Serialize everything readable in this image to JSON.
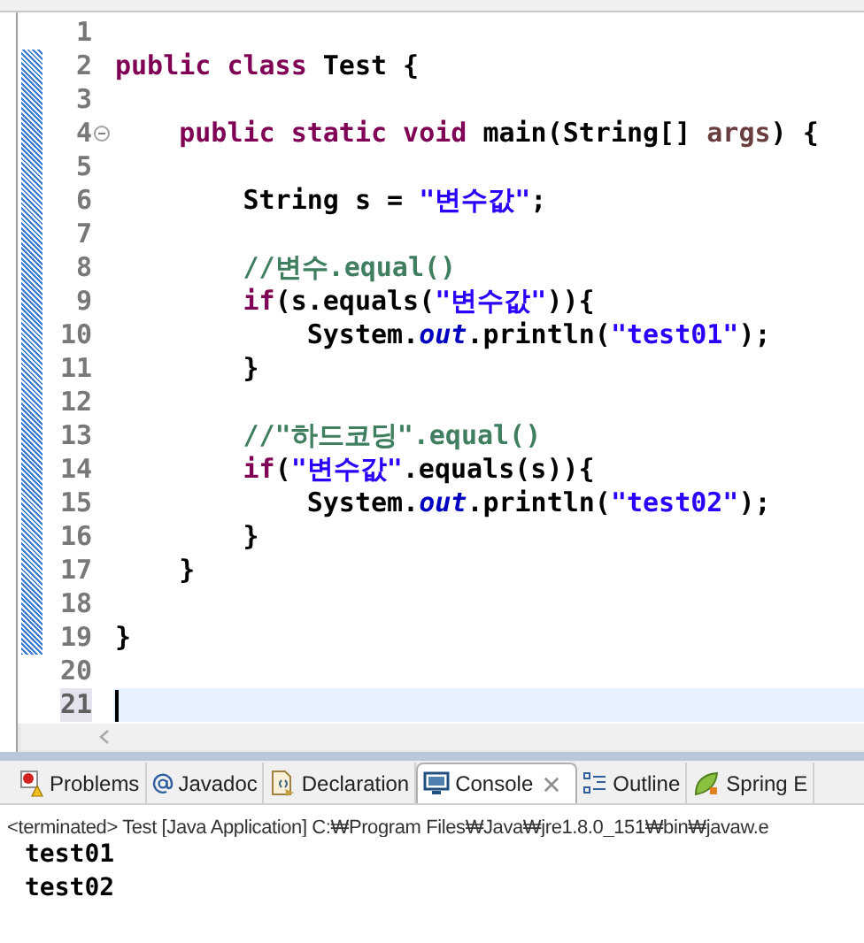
{
  "editor": {
    "lines": [
      {
        "number": "1",
        "current": false
      },
      {
        "number": "2",
        "current": false,
        "tokens": [
          {
            "kind": "keyword",
            "text": "public class"
          },
          {
            "kind": "plain",
            "text": " Test {"
          }
        ]
      },
      {
        "number": "3",
        "current": false
      },
      {
        "number": "4",
        "current": false,
        "fold": {
          "expanded": true
        },
        "tokens": [
          {
            "kind": "keyword",
            "text": "    public static void"
          },
          {
            "kind": "plain",
            "text": " main(String[] "
          },
          {
            "kind": "param",
            "text": "args"
          },
          {
            "kind": "plain",
            "text": ") {"
          }
        ]
      },
      {
        "number": "5",
        "current": false
      },
      {
        "number": "6",
        "current": false,
        "tokens": [
          {
            "kind": "plain",
            "text": "        String "
          },
          {
            "kind": "local",
            "text": "s"
          },
          {
            "kind": "plain",
            "text": " = "
          },
          {
            "kind": "string",
            "text": "\"변수값\""
          },
          {
            "kind": "plain",
            "text": ";"
          }
        ]
      },
      {
        "number": "7",
        "current": false
      },
      {
        "number": "8",
        "current": false,
        "tokens": [
          {
            "kind": "comment",
            "text": "        //변수.equal()"
          }
        ]
      },
      {
        "number": "9",
        "current": false,
        "tokens": [
          {
            "kind": "keyword",
            "text": "        if"
          },
          {
            "kind": "plain",
            "text": "("
          },
          {
            "kind": "local",
            "text": "s"
          },
          {
            "kind": "plain",
            "text": ".equals("
          },
          {
            "kind": "string",
            "text": "\"변수값\""
          },
          {
            "kind": "plain",
            "text": ")){"
          }
        ]
      },
      {
        "number": "10",
        "current": false,
        "tokens": [
          {
            "kind": "plain",
            "text": "            System."
          },
          {
            "kind": "field",
            "text": "out"
          },
          {
            "kind": "plain",
            "text": ".println("
          },
          {
            "kind": "string",
            "text": "\"test01\""
          },
          {
            "kind": "plain",
            "text": ");"
          }
        ]
      },
      {
        "number": "11",
        "current": false,
        "tokens": [
          {
            "kind": "plain",
            "text": "        }"
          }
        ]
      },
      {
        "number": "12",
        "current": false
      },
      {
        "number": "13",
        "current": false,
        "tokens": [
          {
            "kind": "comment",
            "text": "        //\"하드코딩\".equal()"
          }
        ]
      },
      {
        "number": "14",
        "current": false,
        "tokens": [
          {
            "kind": "keyword",
            "text": "        if"
          },
          {
            "kind": "plain",
            "text": "("
          },
          {
            "kind": "string",
            "text": "\"변수값\""
          },
          {
            "kind": "plain",
            "text": ".equals("
          },
          {
            "kind": "local",
            "text": "s"
          },
          {
            "kind": "plain",
            "text": ")){"
          }
        ]
      },
      {
        "number": "15",
        "current": false,
        "tokens": [
          {
            "kind": "plain",
            "text": "            System."
          },
          {
            "kind": "field",
            "text": "out"
          },
          {
            "kind": "plain",
            "text": ".println("
          },
          {
            "kind": "string",
            "text": "\"test02\""
          },
          {
            "kind": "plain",
            "text": ");"
          }
        ]
      },
      {
        "number": "16",
        "current": false,
        "tokens": [
          {
            "kind": "plain",
            "text": "        }"
          }
        ]
      },
      {
        "number": "17",
        "current": false,
        "tokens": [
          {
            "kind": "plain",
            "text": "    }"
          }
        ]
      },
      {
        "number": "18",
        "current": false
      },
      {
        "number": "19",
        "current": false,
        "tokens": [
          {
            "kind": "plain",
            "text": "}"
          }
        ]
      },
      {
        "number": "20",
        "current": false
      },
      {
        "number": "21",
        "current": true
      }
    ]
  },
  "bottom_panel": {
    "tabs": [
      {
        "label": "Problems",
        "selected": false
      },
      {
        "label": "Javadoc",
        "selected": false
      },
      {
        "label": "Declaration",
        "selected": false
      },
      {
        "label": "Console",
        "selected": true
      },
      {
        "label": "Outline",
        "selected": false
      },
      {
        "label": "Spring E",
        "selected": false
      }
    ],
    "console": {
      "status": "<terminated> Test [Java Application] C:₩Program Files₩Java₩jre1.8.0_151₩bin₩javaw.e",
      "output": [
        "test01",
        "test02"
      ]
    }
  }
}
